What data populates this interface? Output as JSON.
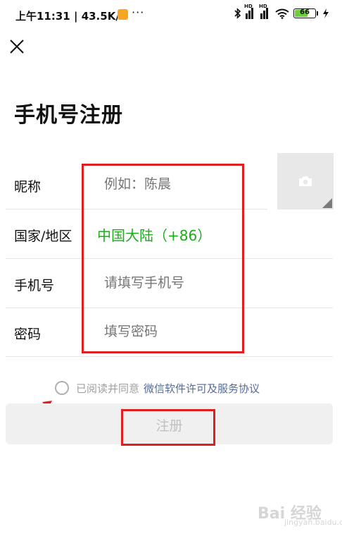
{
  "status_bar": {
    "time": "上午11:31",
    "speed": "43.5K/s",
    "more": "···",
    "battery": "66",
    "battery_level": 0.66,
    "signal_label": "HD"
  },
  "header": {
    "close_icon": "close-icon",
    "title": "手机号注册"
  },
  "form": {
    "nickname": {
      "label": "昵称",
      "placeholder": "例如：陈晨"
    },
    "region": {
      "label": "国家/地区",
      "value": "中国大陆（+86）"
    },
    "phone": {
      "label": "手机号",
      "placeholder": "请填写手机号"
    },
    "password": {
      "label": "密码",
      "placeholder": "填写密码"
    }
  },
  "avatar": {
    "icon": "camera-icon"
  },
  "agreement": {
    "text": "已阅读并同意",
    "link": "微信软件许可及服务协议"
  },
  "submit": {
    "label": "注册"
  },
  "watermark": {
    "text": "Bai 经验",
    "sub": "jingyan.baidu.com"
  },
  "colors": {
    "accent_green": "#1aad19",
    "link_blue": "#576b95",
    "annotation_red": "#e02020"
  }
}
